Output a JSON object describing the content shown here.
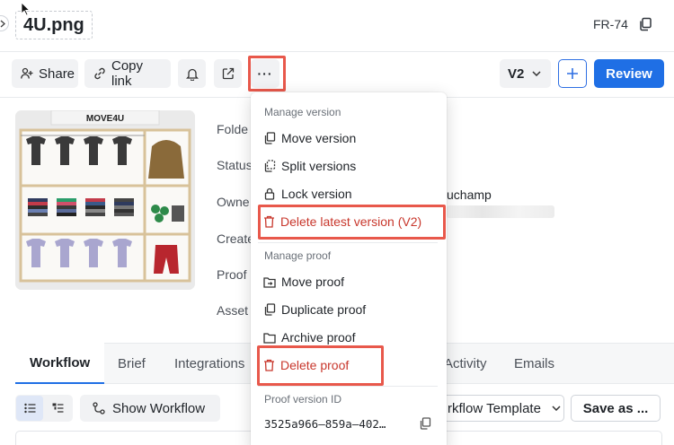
{
  "header": {
    "file_title": "4U.png",
    "file_id": "FR-74"
  },
  "toolbar": {
    "share_label": "Share",
    "copy_link_label": "Copy link",
    "more_label": "···",
    "version_label": "V2",
    "review_label": "Review"
  },
  "asset": {
    "brand_logo": "MOVE4U"
  },
  "details": {
    "labels": [
      "Folde",
      "Status",
      "Owne",
      "Create",
      "Proof",
      "Asset"
    ],
    "owner_value": "uchamp"
  },
  "tabs": [
    "Workflow",
    "Brief",
    "Integrations",
    "Activity",
    "Emails"
  ],
  "actions": {
    "show_workflow_label": "Show Workflow",
    "workflow_template_label": "rkflow Template",
    "save_as_label": "Save as ..."
  },
  "menu": {
    "manage_version_header": "Manage version",
    "version_items": [
      "Move version",
      "Split versions",
      "Lock version",
      "Delete latest version (V2)"
    ],
    "manage_proof_header": "Manage proof",
    "proof_items": [
      "Move proof",
      "Duplicate proof",
      "Archive proof",
      "Delete proof"
    ],
    "proof_version_id_header": "Proof version ID",
    "proof_version_id": "3525a966–859a–402…"
  },
  "colors": {
    "accent": "#1f6fe5",
    "danger": "#c8372c",
    "highlight": "#e8584b"
  }
}
